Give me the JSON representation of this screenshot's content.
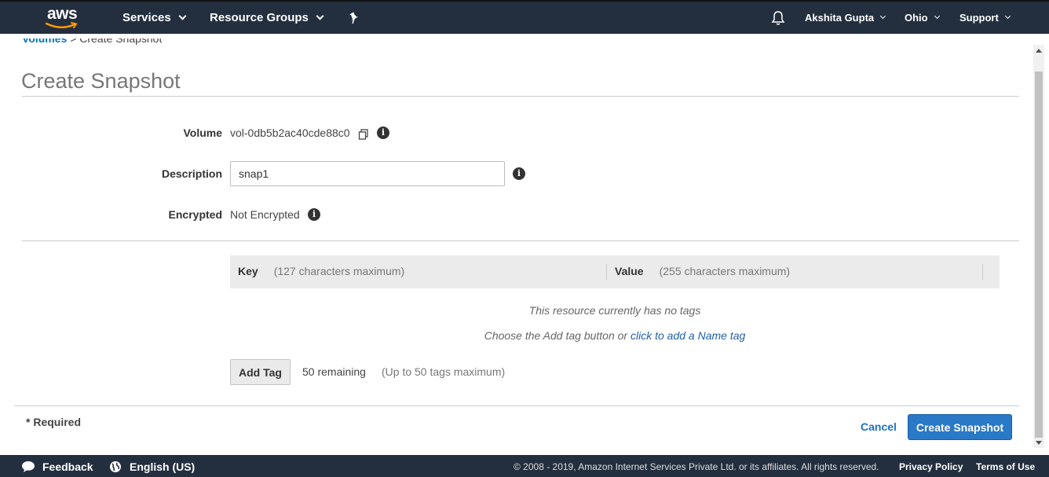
{
  "topnav": {
    "logo_text": "aws",
    "services_label": "Services",
    "resource_groups_label": "Resource Groups",
    "user_label": "Akshita Gupta",
    "region_label": "Ohio",
    "support_label": "Support"
  },
  "breadcrumb": {
    "parent": "Volumes",
    "separator": ">",
    "current": "Create Snapshot"
  },
  "page_title": "Create Snapshot",
  "form": {
    "volume_label": "Volume",
    "volume_value": "vol-0db5b2ac40cde88c0",
    "description_label": "Description",
    "description_value": "snap1",
    "encrypted_label": "Encrypted",
    "encrypted_value": "Not Encrypted"
  },
  "tags": {
    "key_header": "Key",
    "key_hint": "(127 characters maximum)",
    "value_header": "Value",
    "value_hint": "(255 characters maximum)",
    "no_tags_text": "This resource currently has no tags",
    "choose_text": "Choose the Add tag button or",
    "name_tag_link": "click to add a Name tag",
    "add_tag_label": "Add Tag",
    "remaining_text": "50 remaining",
    "max_text": "(Up to 50 tags maximum)"
  },
  "actions": {
    "required_text": "* Required",
    "cancel_label": "Cancel",
    "create_label": "Create Snapshot"
  },
  "footer": {
    "feedback_label": "Feedback",
    "language_label": "English (US)",
    "copyright": "© 2008 - 2019, Amazon Internet Services Private Ltd. or its affiliates. All rights reserved.",
    "privacy_label": "Privacy Policy",
    "terms_label": "Terms of Use"
  },
  "colors": {
    "nav_bg": "#232f3e",
    "link": "#0073bb",
    "primary_button": "#2979c7"
  }
}
